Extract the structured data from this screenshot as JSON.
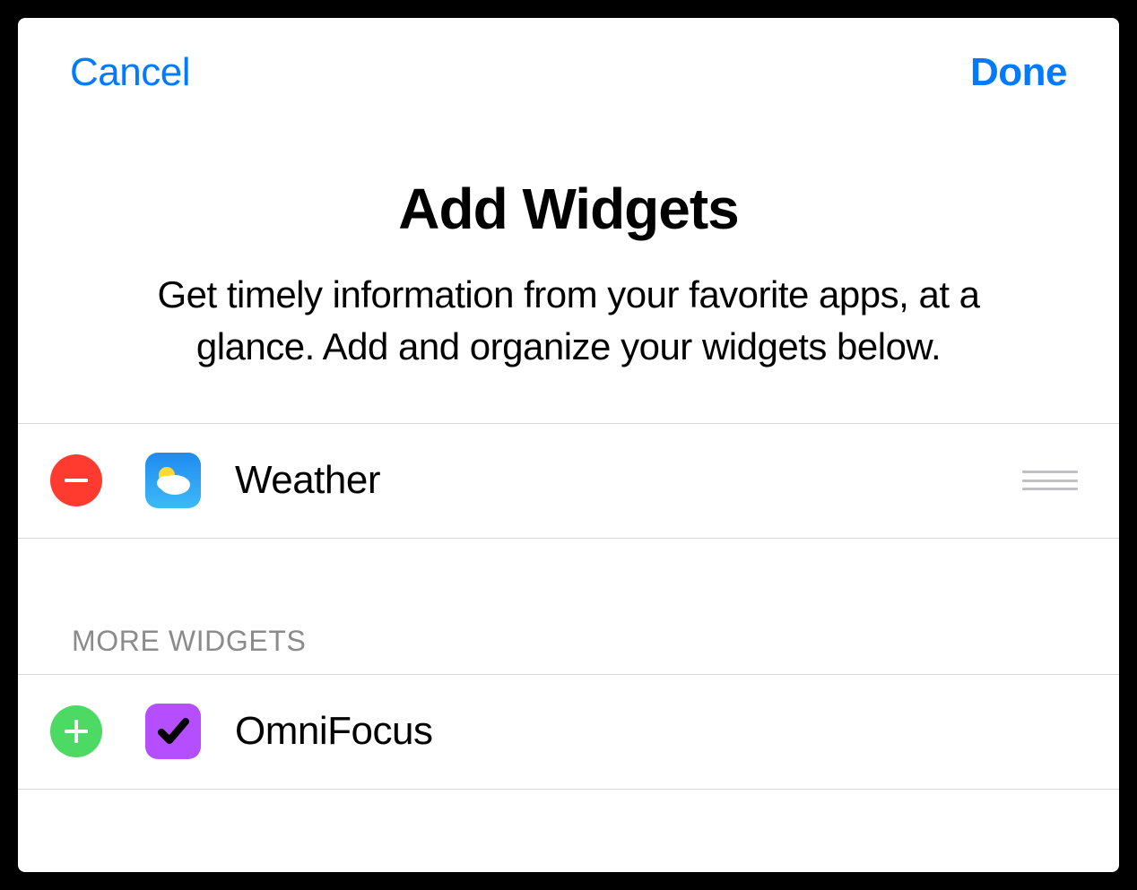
{
  "header": {
    "cancel_label": "Cancel",
    "done_label": "Done"
  },
  "main": {
    "title": "Add Widgets",
    "subtitle": "Get timely information from your favorite apps, at a glance. Add and organize your widgets below."
  },
  "active_widgets": [
    {
      "name": "Weather",
      "icon": "weather"
    }
  ],
  "more_section_label": "MORE WIDGETS",
  "more_widgets": [
    {
      "name": "OmniFocus",
      "icon": "omnifocus"
    }
  ],
  "colors": {
    "accent_blue": "#007aff",
    "remove_red": "#ff3b30",
    "add_green": "#4cd964",
    "weather_gradient_start": "#1f8af0",
    "weather_gradient_end": "#3dbaf7",
    "omnifocus_purple": "#b54eff"
  }
}
